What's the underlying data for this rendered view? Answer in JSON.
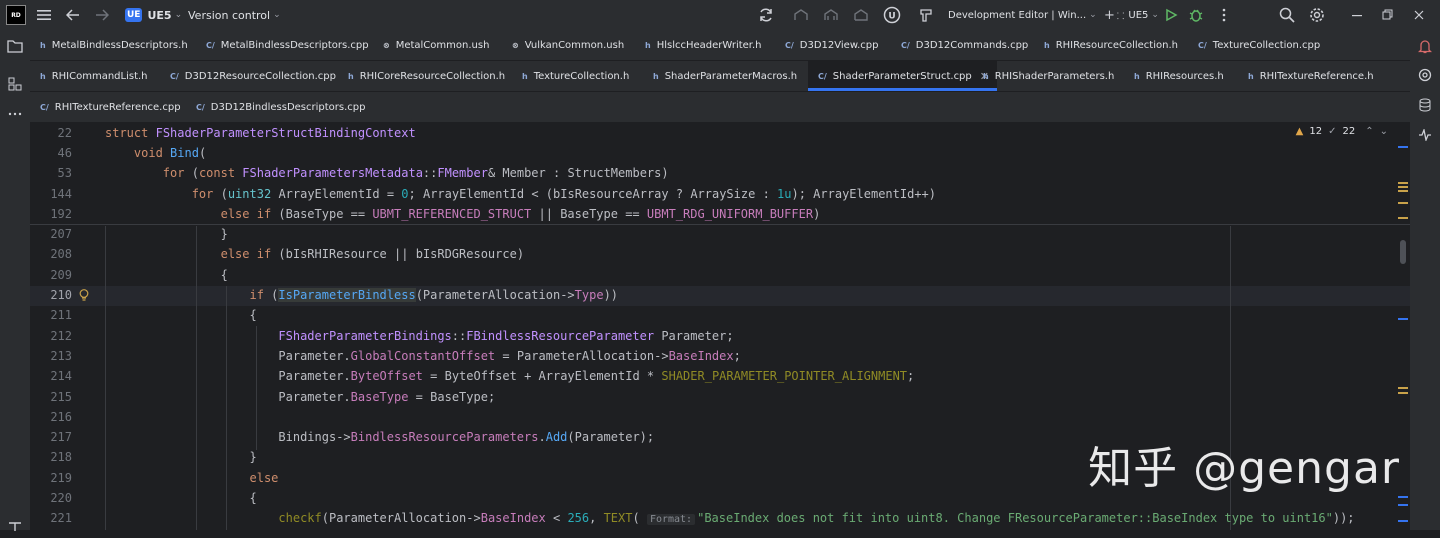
{
  "titlebar": {
    "project_badge": "UE",
    "project_name": "UE5",
    "vcs_label": "Version control",
    "run_config": "Development Editor | Win...",
    "target": "UE5"
  },
  "tabs": {
    "row1": [
      {
        "type": "h",
        "name": "MetalBindlessDescriptors.h"
      },
      {
        "type": "cpp",
        "name": "MetalBindlessDescriptors.cpp"
      },
      {
        "type": "ush",
        "name": "MetalCommon.ush"
      },
      {
        "type": "ush",
        "name": "VulkanCommon.ush"
      },
      {
        "type": "h",
        "name": "HlslccHeaderWriter.h"
      },
      {
        "type": "cpp",
        "name": "D3D12View.cpp"
      },
      {
        "type": "cpp",
        "name": "D3D12Commands.cpp"
      },
      {
        "type": "h",
        "name": "RHIResourceCollection.h"
      },
      {
        "type": "cpp",
        "name": "TextureCollection.cpp"
      }
    ],
    "row2": [
      {
        "type": "h",
        "name": "RHICommandList.h"
      },
      {
        "type": "cpp",
        "name": "D3D12ResourceCollection.cpp"
      },
      {
        "type": "h",
        "name": "RHICoreResourceCollection.h"
      },
      {
        "type": "h",
        "name": "TextureCollection.h"
      },
      {
        "type": "h",
        "name": "ShaderParameterMacros.h"
      },
      {
        "type": "cpp",
        "name": "ShaderParameterStruct.cpp"
      },
      {
        "type": "h",
        "name": "RHIShaderParameters.h"
      },
      {
        "type": "h",
        "name": "RHIResources.h"
      },
      {
        "type": "h",
        "name": "RHITextureReference.h"
      }
    ],
    "row3": [
      {
        "type": "cpp",
        "name": "RHITextureReference.cpp"
      },
      {
        "type": "cpp",
        "name": "D3D12BindlessDescriptors.cpp"
      }
    ],
    "file_type_labels": {
      "h": "h",
      "cpp": "C/",
      "ush": "⊗"
    }
  },
  "editor": {
    "warnings_count": "12",
    "weak_warnings_count": "22",
    "line_numbers": [
      "22",
      "46",
      "53",
      "144",
      "192",
      "207",
      "208",
      "209",
      "210",
      "211",
      "212",
      "213",
      "214",
      "215",
      "216",
      "217",
      "218",
      "219",
      "220",
      "221"
    ],
    "format_hint": "Format:"
  },
  "watermark": "知乎 @gengar",
  "colors": {
    "accent": "#3574f0",
    "background": "#1e1f22",
    "panel": "#2b2d30"
  }
}
